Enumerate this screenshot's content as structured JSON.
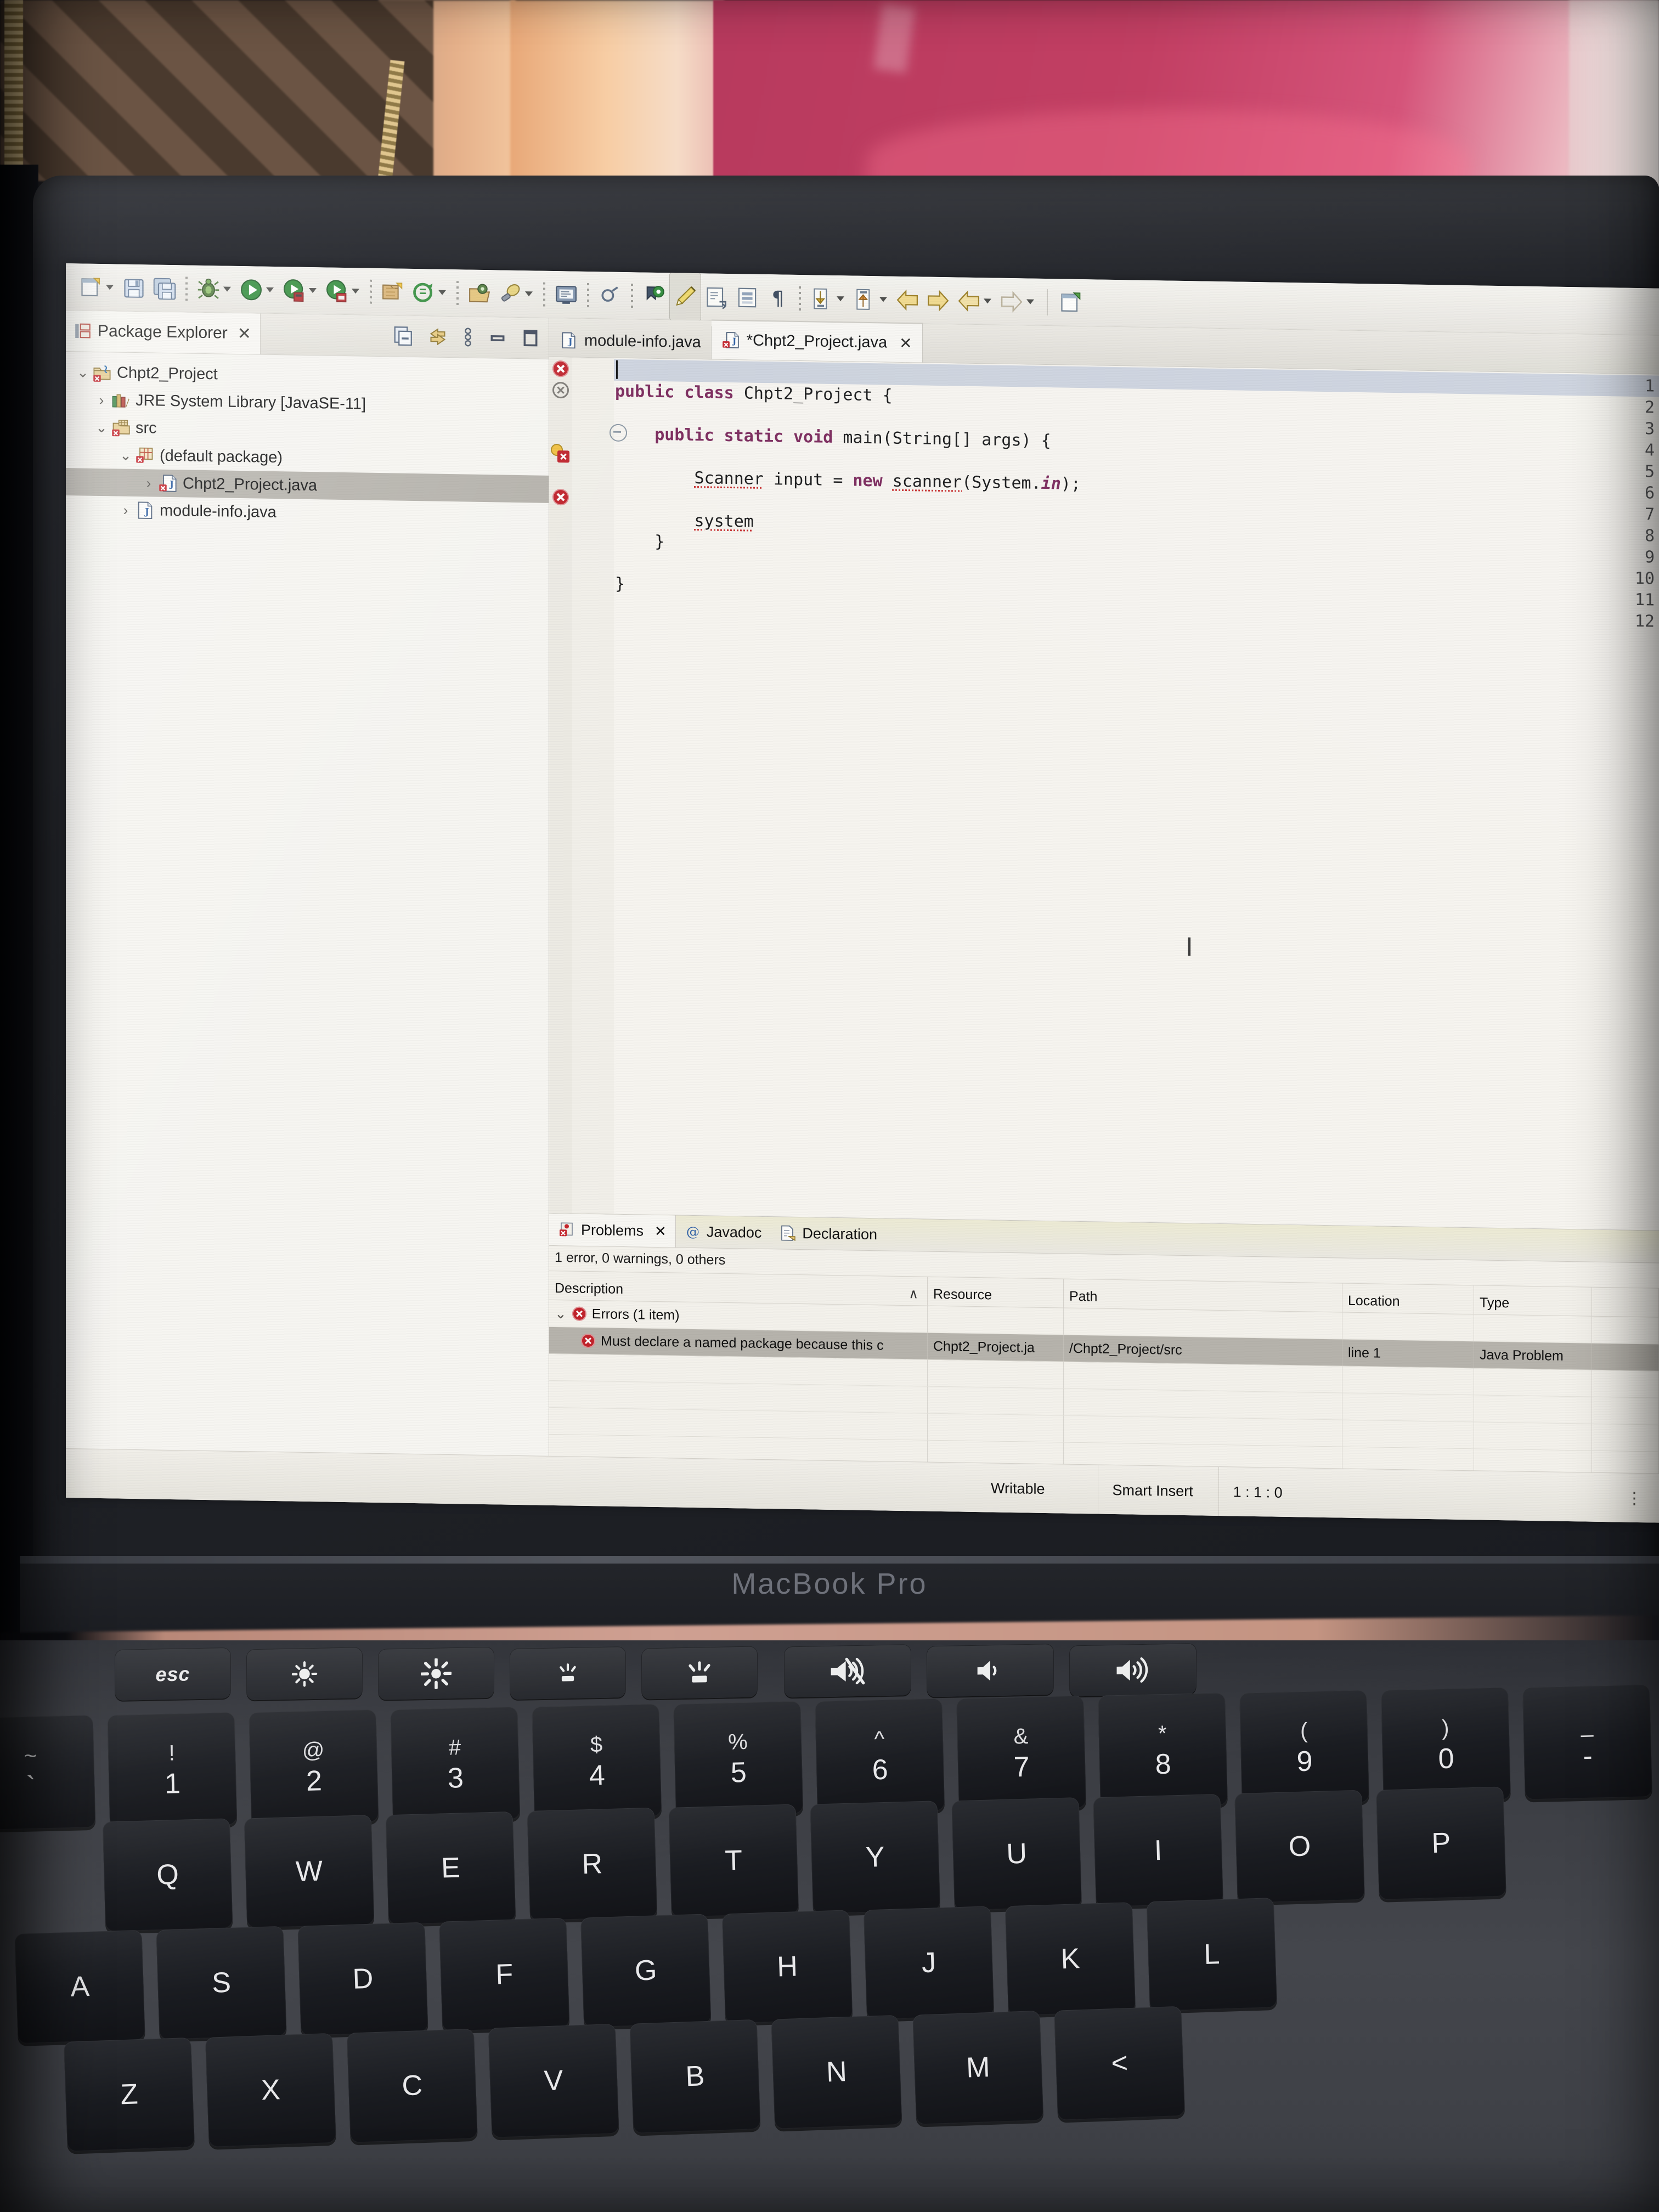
{
  "device": {
    "brand_label": "MacBook Pro"
  },
  "window": {
    "min_button": "minimize",
    "restore_button": "restore"
  },
  "toolbar": {
    "items": [
      {
        "name": "new-wizard-icon",
        "label": "New",
        "has_dropdown": true
      },
      {
        "name": "save-icon",
        "label": "Save",
        "has_dropdown": false
      },
      {
        "name": "save-all-icon",
        "label": "Save All",
        "has_dropdown": false
      },
      {
        "name": "debug-icon",
        "label": "Debug",
        "has_dropdown": true
      },
      {
        "name": "run-icon",
        "label": "Run",
        "has_dropdown": true
      },
      {
        "name": "coverage-icon",
        "label": "Coverage",
        "has_dropdown": true
      },
      {
        "name": "run-last-tool-icon",
        "label": "Run Last Tool",
        "has_dropdown": true
      },
      {
        "name": "new-java-project-icon",
        "label": "New Java Project",
        "has_dropdown": false
      },
      {
        "name": "new-java-class-icon",
        "label": "New Java Class",
        "has_dropdown": true
      },
      {
        "name": "open-type-icon",
        "label": "Open Type",
        "has_dropdown": false
      },
      {
        "name": "search-icon",
        "label": "Search",
        "has_dropdown": true
      },
      {
        "name": "console-icon",
        "label": "Open Console",
        "has_dropdown": false
      },
      {
        "name": "link-icon",
        "label": "Link",
        "has_dropdown": false
      },
      {
        "name": "skip-breakpoints-icon",
        "label": "Skip All Breakpoints",
        "has_dropdown": false
      },
      {
        "name": "pencil-icon",
        "label": "Toggle Mark Occurrences",
        "has_dropdown": false
      },
      {
        "name": "next-annotation-icon",
        "label": "Next Annotation",
        "has_dropdown": false
      },
      {
        "name": "block-selection-icon",
        "label": "Toggle Block Selection",
        "has_dropdown": false
      },
      {
        "name": "whitespace-icon",
        "label": "Show Whitespace Characters",
        "has_dropdown": false
      },
      {
        "name": "next-edit-icon",
        "label": "Next Edit Location",
        "has_dropdown": true
      },
      {
        "name": "previous-edit-icon",
        "label": "Previous Edit Location",
        "has_dropdown": true
      },
      {
        "name": "back-icon",
        "label": "Back",
        "has_dropdown": false
      },
      {
        "name": "forward-icon",
        "label": "Forward",
        "has_dropdown": false
      },
      {
        "name": "previous-icon",
        "label": "Previous",
        "has_dropdown": true
      },
      {
        "name": "next-icon",
        "label": "Next",
        "has_dropdown": true
      },
      {
        "name": "open-perspective-icon",
        "label": "Open Perspective",
        "has_dropdown": false
      }
    ]
  },
  "package_explorer": {
    "tab_label": "Package Explorer",
    "tab_close": "✕",
    "view_tools": [
      {
        "name": "collapse-all-icon",
        "label": "Collapse All"
      },
      {
        "name": "link-with-editor-icon",
        "label": "Link with Editor"
      },
      {
        "name": "view-menu-icon",
        "label": "View Menu"
      },
      {
        "name": "minimize-view-icon",
        "label": "Minimize"
      },
      {
        "name": "maximize-view-icon",
        "label": "Maximize"
      }
    ],
    "tree": [
      {
        "label": "Chpt2_Project",
        "indent": 0,
        "twisty": "⌄",
        "icon": "java-project-error-icon",
        "selected": false
      },
      {
        "label": "JRE System Library [JavaSE-11]",
        "indent": 1,
        "twisty": "›",
        "icon": "jre-library-icon",
        "selected": false
      },
      {
        "label": "src",
        "indent": 1,
        "twisty": "⌄",
        "icon": "source-folder-error-icon",
        "selected": false
      },
      {
        "label": "(default package)",
        "indent": 2,
        "twisty": "⌄",
        "icon": "package-error-icon",
        "selected": false
      },
      {
        "label": "Chpt2_Project.java",
        "indent": 3,
        "twisty": "›",
        "icon": "java-file-error-icon",
        "selected": true
      },
      {
        "label": "module-info.java",
        "indent": 2,
        "twisty": "›",
        "icon": "java-file-icon",
        "selected": false
      }
    ]
  },
  "editor": {
    "tabs": [
      {
        "label": "module-info.java",
        "icon": "java-file-icon",
        "active": false,
        "closable": false,
        "dirty": false
      },
      {
        "label": "*Chpt2_Project.java",
        "icon": "java-file-error-icon",
        "active": true,
        "closable": true,
        "dirty": true
      }
    ],
    "tab_close": "✕",
    "current_line": 1,
    "lines": [
      {
        "n": 1,
        "marker": "error",
        "fold": false,
        "text": ""
      },
      {
        "n": 2,
        "marker": "error-gray",
        "fold": false,
        "text": "public class Chpt2_Project {"
      },
      {
        "n": 3,
        "marker": "",
        "fold": false,
        "text": ""
      },
      {
        "n": 4,
        "marker": "",
        "fold": true,
        "text": "    public static void main(String[] args) {"
      },
      {
        "n": 5,
        "marker": "",
        "fold": false,
        "text": ""
      },
      {
        "n": 6,
        "marker": "quickfix",
        "fold": false,
        "text": "        Scanner input = new scanner(System.in);"
      },
      {
        "n": 7,
        "marker": "",
        "fold": false,
        "text": ""
      },
      {
        "n": 8,
        "marker": "error",
        "fold": false,
        "text": "        system"
      },
      {
        "n": 9,
        "marker": "",
        "fold": false,
        "text": "    }"
      },
      {
        "n": 10,
        "marker": "",
        "fold": false,
        "text": ""
      },
      {
        "n": 11,
        "marker": "",
        "fold": false,
        "text": "}"
      },
      {
        "n": 12,
        "marker": "",
        "fold": false,
        "text": ""
      }
    ]
  },
  "problems": {
    "tabs": [
      {
        "label": "Problems",
        "icon": "problems-icon",
        "active": true,
        "closable": true
      },
      {
        "label": "Javadoc",
        "icon": "javadoc-at-icon",
        "active": false,
        "closable": false
      },
      {
        "label": "Declaration",
        "icon": "declaration-icon",
        "active": false,
        "closable": false
      }
    ],
    "tab_close": "✕",
    "summary": "1 error, 0 warnings, 0 others",
    "columns": [
      "Description",
      "Resource",
      "Path",
      "Location",
      "Type"
    ],
    "sort_indicator": "∧",
    "group": {
      "twisty": "⌄",
      "label": "Errors (1 item)",
      "icon": "error-icon"
    },
    "rows": [
      {
        "icon": "error-icon",
        "description": "Must declare a named package because this c",
        "resource": "Chpt2_Project.ja",
        "path": "/Chpt2_Project/src",
        "location": "line 1",
        "type": "Java Problem",
        "selected": true
      }
    ]
  },
  "status_bar": {
    "writable": "Writable",
    "insert_mode": "Smart Insert",
    "cursor_position": "1 : 1 : 0",
    "overflow_menu": "⋮"
  },
  "touch_bar": {
    "keys": [
      {
        "name": "esc-key",
        "label": "esc",
        "glyph": "text"
      },
      {
        "name": "brightness-down-key",
        "label": "",
        "glyph": "brightness-low-icon"
      },
      {
        "name": "brightness-up-key",
        "label": "",
        "glyph": "brightness-high-icon"
      },
      {
        "name": "keyboard-backlight-down-key",
        "label": "",
        "glyph": "keyboard-light-low-icon"
      },
      {
        "name": "keyboard-backlight-up-key",
        "label": "",
        "glyph": "keyboard-light-high-icon"
      },
      {
        "name": "mute-key",
        "label": "",
        "glyph": "mute-icon"
      },
      {
        "name": "volume-down-key",
        "label": "",
        "glyph": "volume-low-icon"
      },
      {
        "name": "volume-up-key",
        "label": "",
        "glyph": "volume-high-icon"
      }
    ]
  },
  "keyboard": {
    "row_number": [
      {
        "top": "~",
        "bottom": "`"
      },
      {
        "top": "!",
        "bottom": "1"
      },
      {
        "top": "@",
        "bottom": "2"
      },
      {
        "top": "#",
        "bottom": "3"
      },
      {
        "top": "$",
        "bottom": "4"
      },
      {
        "top": "%",
        "bottom": "5"
      },
      {
        "top": "^",
        "bottom": "6"
      },
      {
        "top": "&",
        "bottom": "7"
      },
      {
        "top": "*",
        "bottom": "8"
      },
      {
        "top": "(",
        "bottom": "9"
      },
      {
        "top": ")",
        "bottom": "0"
      },
      {
        "top": "_",
        "bottom": "-"
      }
    ],
    "row_top": [
      "Q",
      "W",
      "E",
      "R",
      "T",
      "Y",
      "U",
      "I",
      "O",
      "P"
    ],
    "row_home": [
      "A",
      "S",
      "D",
      "F",
      "G",
      "H",
      "J",
      "K",
      "L"
    ],
    "row_bottom": [
      "Z",
      "X",
      "C",
      "V",
      "B",
      "N",
      "M",
      "<"
    ]
  },
  "colors": {
    "error_red": "#c0232b",
    "keyword_purple": "#7c2a5c",
    "selection_gray": "#b6b3ac",
    "current_line_blue": "#cdd3de",
    "screen_bg": "#f4f3ef",
    "lid_dark": "#23252a",
    "pink_object": "#c23f63"
  }
}
